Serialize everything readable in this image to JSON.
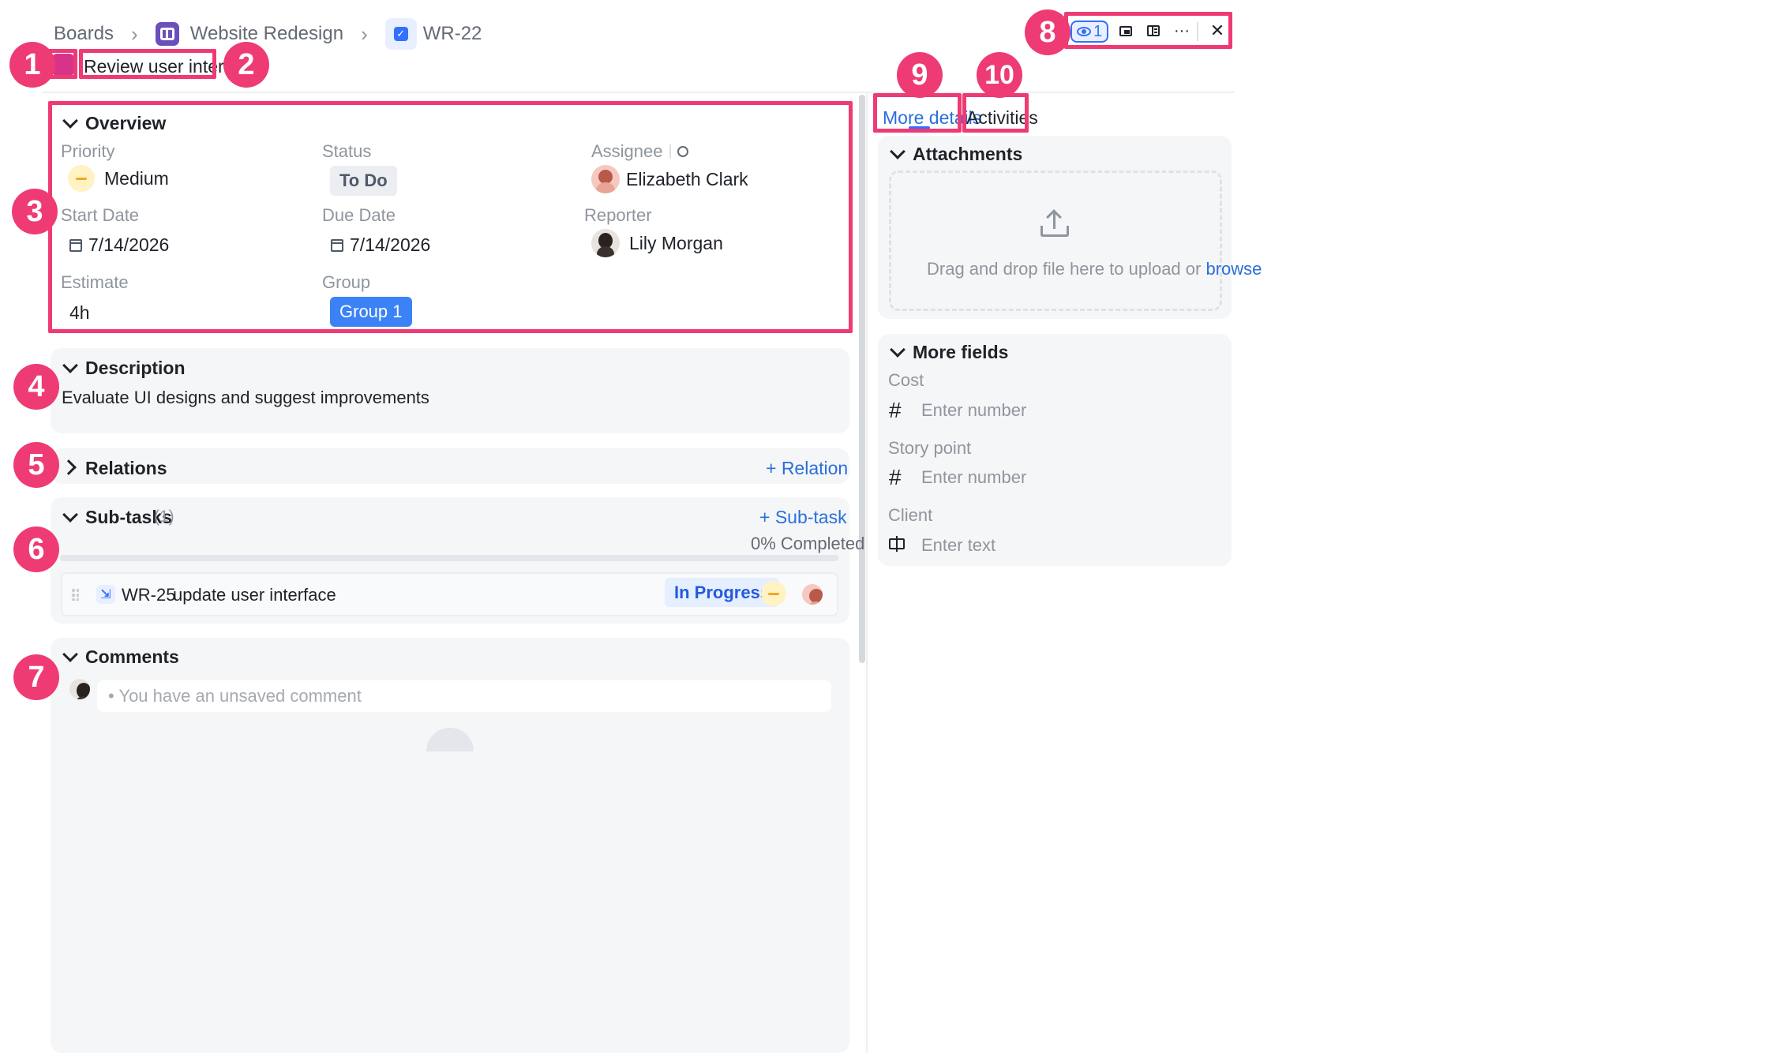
{
  "breadcrumb": {
    "boards": "Boards",
    "project": "Website Redesign",
    "task_id": "WR-22"
  },
  "task": {
    "title": "Review user interface",
    "color": "#d9328a"
  },
  "toolbar": {
    "watch_count": "1",
    "more": "···",
    "close": "✕",
    "icons": [
      "eye-icon",
      "picture-in-picture-icon",
      "side-panel-icon",
      "more-icon",
      "close-icon"
    ]
  },
  "tabs": {
    "more_details": "More details",
    "activities": "Activities"
  },
  "overview": {
    "title": "Overview",
    "priority_label": "Priority",
    "priority_value": "Medium",
    "status_label": "Status",
    "status_value": "To Do",
    "assignee_label": "Assignee",
    "assignee_value": "Elizabeth Clark",
    "start_label": "Start Date",
    "start_value": "7/14/2026",
    "due_label": "Due Date",
    "due_value": "7/14/2026",
    "reporter_label": "Reporter",
    "reporter_value": "Lily Morgan",
    "estimate_label": "Estimate",
    "estimate_value": "4h",
    "group_label": "Group",
    "group_value": "Group 1"
  },
  "description": {
    "title": "Description",
    "text": "Evaluate UI designs and suggest improvements"
  },
  "relations": {
    "title": "Relations",
    "add": "+ Relation"
  },
  "subtasks": {
    "title": "Sub-tasks",
    "count": "(1)",
    "add": "+ Sub-task",
    "progress_text": "0% Completed",
    "progress": 0,
    "items": [
      {
        "id": "WR-25",
        "name": "update user interface",
        "status": "In Progress"
      }
    ]
  },
  "comments": {
    "title": "Comments",
    "placeholder": "• You have an unsaved comment"
  },
  "attachments": {
    "title": "Attachments",
    "drop_text": "Drag and drop file here to upload or",
    "browse": "browse"
  },
  "more_fields": {
    "title": "More fields",
    "cost_label": "Cost",
    "cost_placeholder": "Enter number",
    "story_label": "Story point",
    "story_placeholder": "Enter number",
    "client_label": "Client",
    "client_placeholder": "Enter text"
  },
  "annotations": [
    "1",
    "2",
    "3",
    "4",
    "5",
    "6",
    "7",
    "8",
    "9",
    "10"
  ],
  "colors": {
    "highlight": "#ee3b74",
    "accent": "#3370ff",
    "group": "#3b82f6"
  }
}
